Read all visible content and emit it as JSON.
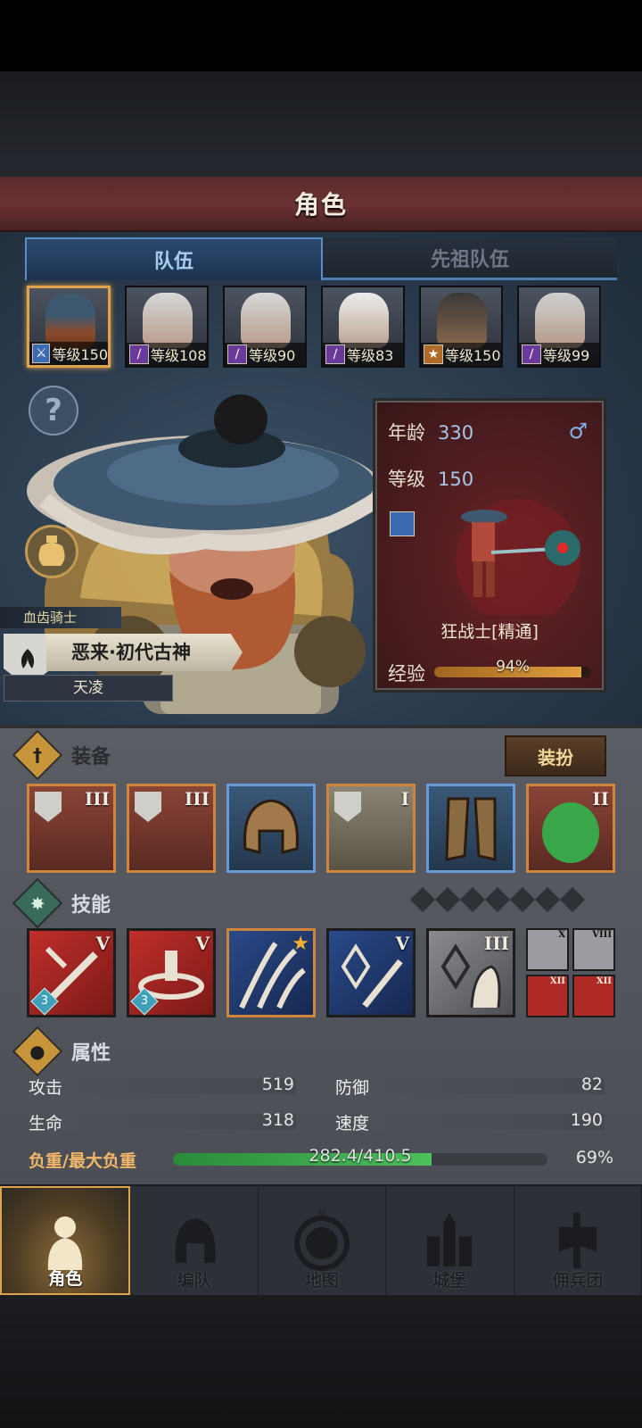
{
  "header": {
    "title": "角色"
  },
  "tabs": [
    {
      "label": "队伍"
    },
    {
      "label": "先祖队伍"
    }
  ],
  "roster": [
    {
      "level_text": "等级150",
      "class_color": "#3b6ab0",
      "selected": true
    },
    {
      "level_text": "等级108",
      "class_color": "#6a3a9a"
    },
    {
      "level_text": "等级90",
      "class_color": "#6a3a9a"
    },
    {
      "level_text": "等级83",
      "class_color": "#6a3a9a"
    },
    {
      "level_text": "等级150",
      "class_color": "#b06a28"
    },
    {
      "level_text": "等级99",
      "class_color": "#6a3a9a"
    }
  ],
  "hero": {
    "rank": "血齿骑士",
    "name": "恶来·初代古神",
    "title": "天凌"
  },
  "card": {
    "age_label": "年龄",
    "age_value": "330",
    "gender_icon": "male-icon",
    "level_label": "等级",
    "level_value": "150",
    "class_name": "狂战士[精通]",
    "exp_label": "经验",
    "exp_pct": "94%",
    "exp_fraction": 0.94
  },
  "equipment": {
    "title": "装备",
    "dress_button": "装扮",
    "items": [
      {
        "tier": "III",
        "rarity": "orange"
      },
      {
        "tier": "III",
        "rarity": "orange"
      },
      {
        "tier": "",
        "rarity": "blue"
      },
      {
        "tier": "I",
        "rarity": "orange"
      },
      {
        "tier": "",
        "rarity": "blue"
      },
      {
        "tier": "II",
        "rarity": "orange"
      }
    ]
  },
  "skills": {
    "title": "技能",
    "slots_total": 7,
    "items": [
      {
        "tier": "V",
        "count": "3"
      },
      {
        "tier": "V",
        "count": "3"
      },
      {
        "tier": "",
        "starred": true
      },
      {
        "tier": "V"
      },
      {
        "tier": "III"
      }
    ],
    "passives": [
      "X",
      "VIII",
      "XII",
      "XII"
    ]
  },
  "attributes": {
    "title": "属性",
    "attack_label": "攻击",
    "attack_value": "519",
    "defense_label": "防御",
    "defense_value": "82",
    "hp_label": "生命",
    "hp_value": "318",
    "speed_label": "速度",
    "speed_value": "190",
    "load_label": "负重/最大负重",
    "load_text": "282.4/410.5",
    "load_pct": "69%",
    "load_fraction": 0.69
  },
  "nav": [
    {
      "label": "角色",
      "active": true
    },
    {
      "label": "编队"
    },
    {
      "label": "地图"
    },
    {
      "label": "城堡"
    },
    {
      "label": "佣兵团"
    }
  ]
}
